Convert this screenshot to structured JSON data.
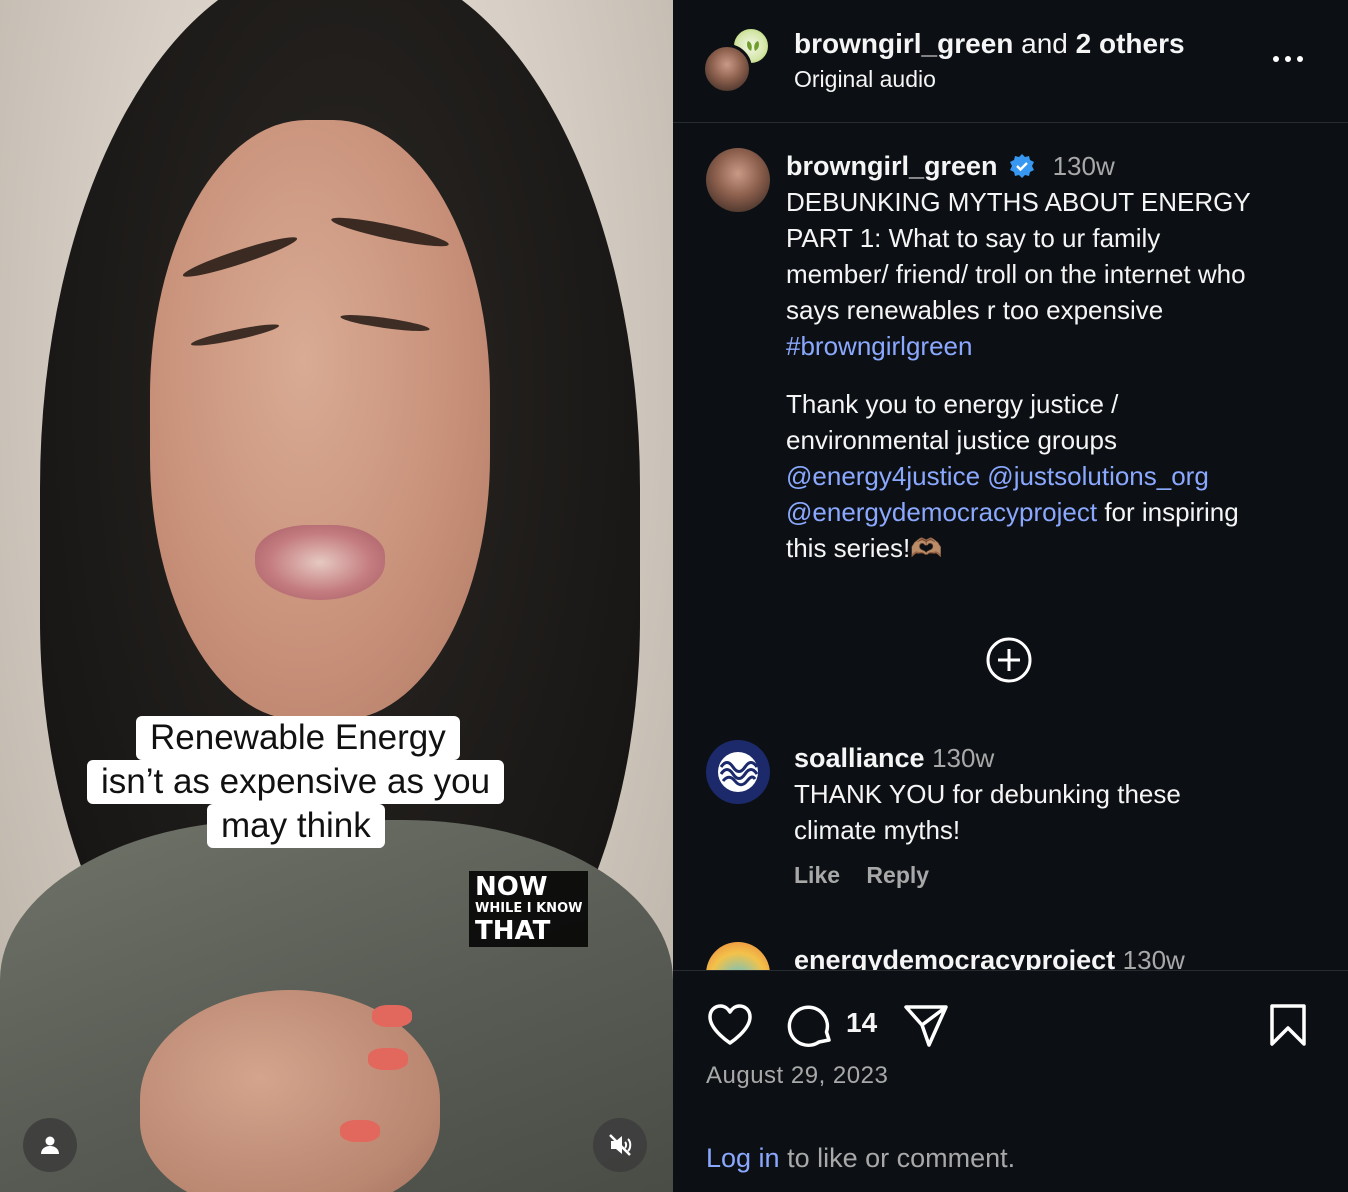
{
  "video": {
    "caption_lines": [
      "Renewable Energy",
      "isn’t as expensive as you",
      "may think"
    ],
    "logo": {
      "line1": "NOW",
      "line2": "WHILE I KNOW",
      "line3": "THAT"
    }
  },
  "header": {
    "username": "browngirl_green",
    "and_text": "and",
    "others": "2 others",
    "audio": "Original audio"
  },
  "caption": {
    "username": "browngirl_green",
    "age": "130w",
    "paragraph1": [
      "DEBUNKING MYTHS ABOUT ENERGY",
      "PART 1: What to say to ur family",
      "member/ friend/ troll on the internet who",
      "says renewables r too expensive"
    ],
    "hashtag": "#browngirlgreen",
    "paragraph2_line1": "Thank you to energy justice /",
    "paragraph2_line2": "environmental justice groups",
    "mention1": "@energy4justice",
    "mention2": "@justsolutions_org",
    "mention3": "@energydemocracyproject",
    "after_mentions": "for inspiring",
    "closing": "this series!🫶🏽"
  },
  "comments": [
    {
      "username": "soalliance",
      "age": "130w",
      "text_lines": [
        "THANK YOU for debunking these",
        "climate myths!"
      ],
      "like_label": "Like",
      "reply_label": "Reply"
    },
    {
      "username": "energydemocracyproject",
      "age": "130w"
    }
  ],
  "footer": {
    "comment_count": "14",
    "date": "August 29, 2023",
    "login_link": "Log in",
    "login_rest": "to like or comment."
  },
  "colors": {
    "background": "#0c1014",
    "link": "#8ba8ff",
    "verified": "#3897f0",
    "muted": "#a8a8a8"
  }
}
